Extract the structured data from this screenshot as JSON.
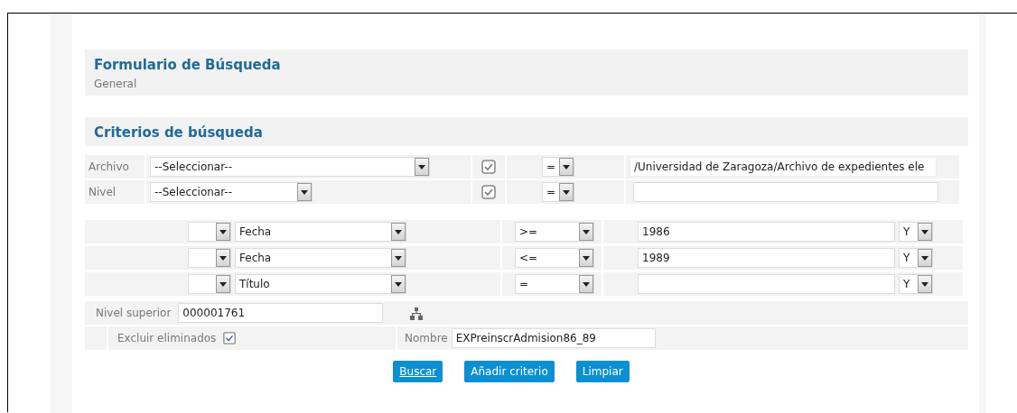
{
  "title": "Formulario de Búsqueda",
  "subtitle": "General",
  "criteria_title": "Criterios de búsqueda",
  "fixed_criteria": [
    {
      "label": "Archivo",
      "select": "--Seleccionar--",
      "checked": true,
      "operator": "=",
      "value": "/Universidad de Zaragoza/Archivo de expedientes ele"
    },
    {
      "label": "Nivel",
      "select": "--Seleccionar--",
      "checked": true,
      "operator": "="
    }
  ],
  "criteria": [
    {
      "field": "Fecha",
      "operator": ">=",
      "value": "1986",
      "connector": "Y"
    },
    {
      "field": "Fecha",
      "operator": "<=",
      "value": "1989",
      "connector": "Y"
    },
    {
      "field": "Título",
      "operator": "=",
      "connector": "Y"
    }
  ],
  "parent_level": {
    "label": "Nivel superior",
    "value": "000001761"
  },
  "exclude_deleted": {
    "label": "Excluir eliminados",
    "checked": true
  },
  "name_field": {
    "label": "Nombre",
    "value": "EXPreinscrAdmision86_89"
  },
  "buttons": [
    {
      "label": "Buscar",
      "underlined": true
    },
    {
      "label": "Añadir criterio",
      "underlined": false
    },
    {
      "label": "Limpiar",
      "underlined": false
    }
  ]
}
